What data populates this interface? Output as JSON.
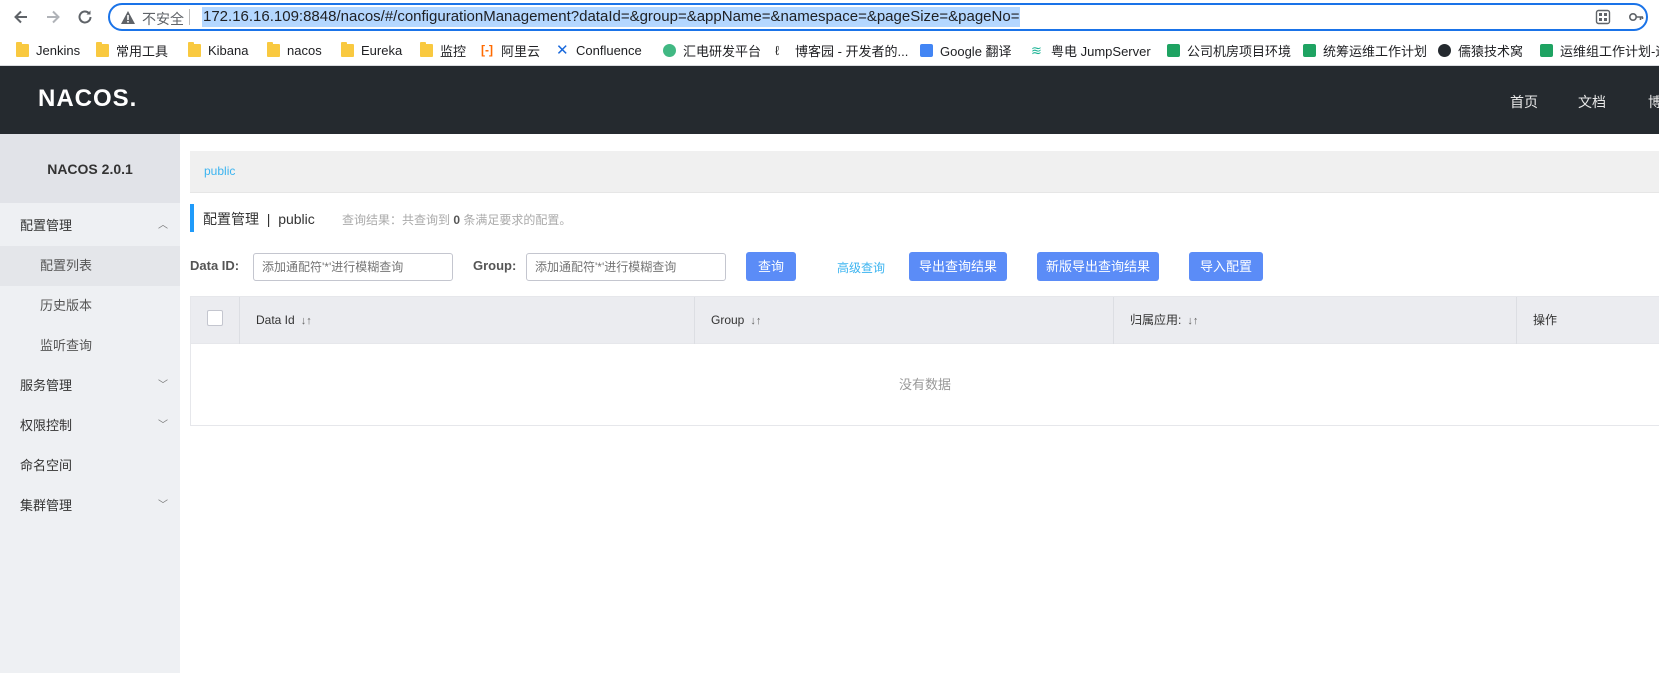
{
  "browser": {
    "insecure_label": "不安全",
    "url": "172.16.16.109:8848/nacos/#/configurationManagement?dataId=&group=&appName=&namespace=&pageSize=&pageNo="
  },
  "bookmarks": [
    {
      "label": "Jenkins",
      "icon": "folder-icon"
    },
    {
      "label": "常用工具",
      "icon": "folder-icon"
    },
    {
      "label": "Kibana",
      "icon": "folder-icon"
    },
    {
      "label": "nacos",
      "icon": "folder-icon"
    },
    {
      "label": "Eureka",
      "icon": "folder-icon"
    },
    {
      "label": "监控",
      "icon": "folder-icon"
    },
    {
      "label": "阿里云",
      "icon": "aliyun-icon"
    },
    {
      "label": "Confluence",
      "icon": "confluence-icon"
    },
    {
      "label": "汇电研发平台",
      "icon": "vue-icon"
    },
    {
      "label": "博客园 - 开发者的...",
      "icon": "cnblogs-icon"
    },
    {
      "label": "Google 翻译",
      "icon": "translate-icon"
    },
    {
      "label": "粤电 JumpServer",
      "icon": "jumpserver-icon"
    },
    {
      "label": "公司机房项目环境",
      "icon": "sheet-icon"
    },
    {
      "label": "统筹运维工作计划",
      "icon": "sheet-icon"
    },
    {
      "label": "儒猿技术窝",
      "icon": "github-icon"
    },
    {
      "label": "运维组工作计划-运",
      "icon": "sheet-icon"
    }
  ],
  "header": {
    "logo_text": "NACOS.",
    "nav": [
      "首页",
      "文档",
      "博"
    ]
  },
  "sidebar": {
    "version": "NACOS 2.0.1",
    "items": [
      {
        "label": "配置管理",
        "level": "top",
        "expanded": true
      },
      {
        "label": "配置列表",
        "level": "sub",
        "active": true
      },
      {
        "label": "历史版本",
        "level": "sub"
      },
      {
        "label": "监听查询",
        "level": "sub"
      },
      {
        "label": "服务管理",
        "level": "top",
        "expanded": false
      },
      {
        "label": "权限控制",
        "level": "top",
        "expanded": false
      },
      {
        "label": "命名空间",
        "level": "top"
      },
      {
        "label": "集群管理",
        "level": "top",
        "expanded": false
      }
    ]
  },
  "content": {
    "namespace_tab": "public",
    "title": "配置管理  |  public",
    "query_summary_prefix": "查询结果：共查询到",
    "query_count": "0",
    "query_summary_suffix": "条满足要求的配置。",
    "dataid_label": "Data ID:",
    "dataid_placeholder": "添加通配符'*'进行模糊查询",
    "group_label": "Group:",
    "group_placeholder": "添加通配符'*'进行模糊查询",
    "search_button": "查询",
    "advanced_link": "高级查询",
    "export_button": "导出查询结果",
    "new_export_button": "新版导出查询结果",
    "import_button": "导入配置",
    "table": {
      "columns": [
        "Data Id",
        "Group",
        "归属应用:",
        "操作"
      ],
      "empty_text": "没有数据"
    }
  },
  "colors": {
    "header_bg": "#252a2f",
    "primary_button": "#5b8cf7",
    "link": "#3cb4f0"
  }
}
